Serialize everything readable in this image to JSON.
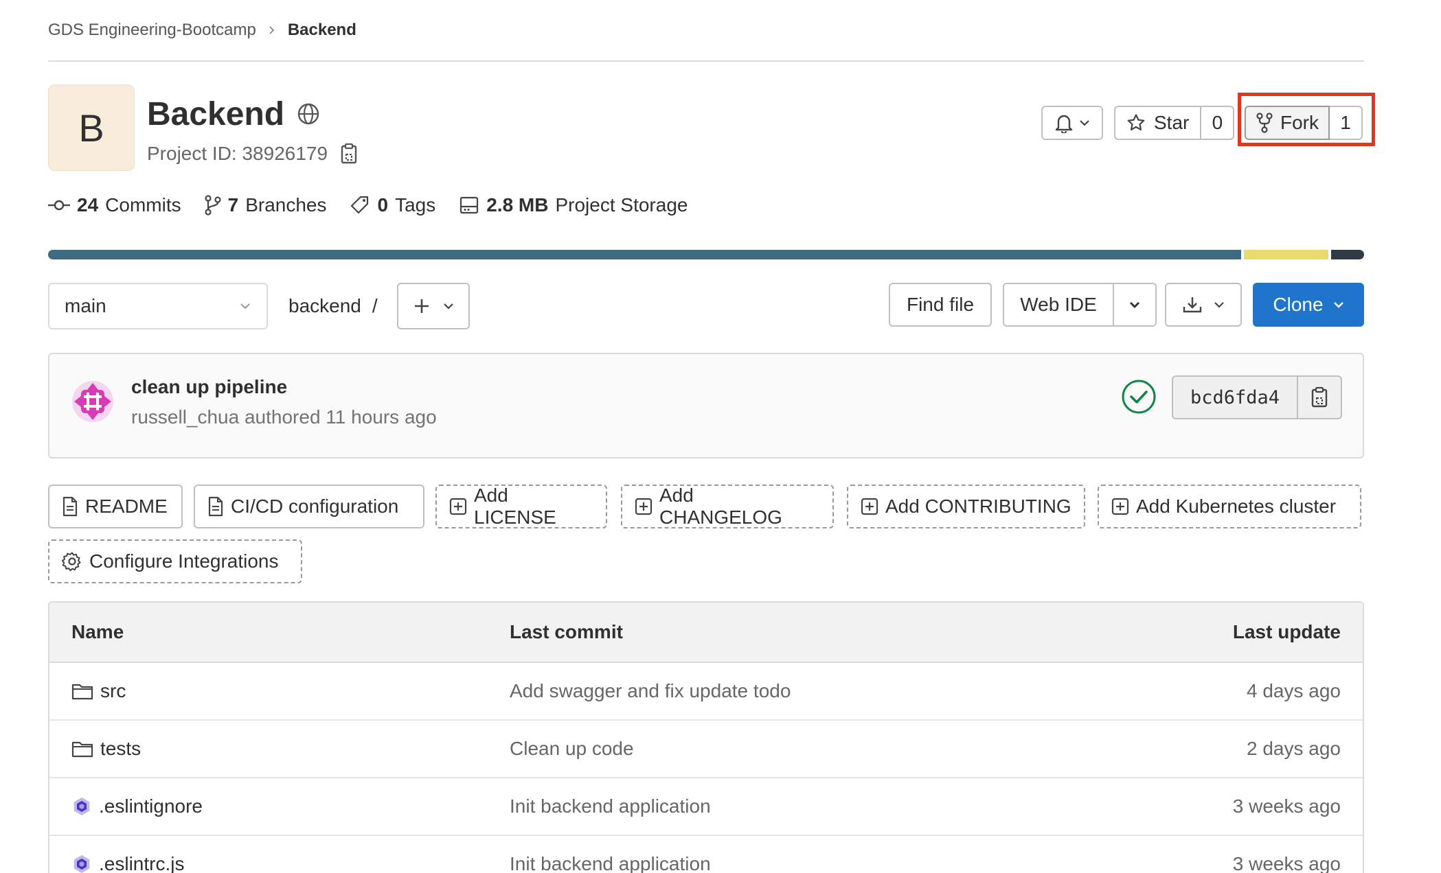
{
  "breadcrumb": {
    "group": "GDS Engineering-Bootcamp",
    "project": "Backend"
  },
  "project": {
    "avatar_letter": "B",
    "name": "Backend",
    "id_label": "Project ID: 38926179"
  },
  "header_actions": {
    "star_label": "Star",
    "star_count": "0",
    "fork_label": "Fork",
    "fork_count": "1"
  },
  "stats": [
    {
      "count": "24",
      "label": "Commits"
    },
    {
      "count": "7",
      "label": "Branches"
    },
    {
      "count": "0",
      "label": "Tags"
    },
    {
      "count": "2.8 MB",
      "label": "Project Storage"
    }
  ],
  "language_bar": [
    {
      "share": 0.8,
      "color": "#3e6b80"
    },
    {
      "share": 0.057,
      "color": "#e9dc6c"
    },
    {
      "share": 0.022,
      "color": "#2f3a44"
    }
  ],
  "toolbar": {
    "branch": "main",
    "path": "backend",
    "path_sep": "/",
    "find_file": "Find file",
    "web_ide": "Web IDE",
    "clone": "Clone"
  },
  "last_commit": {
    "title": "clean up pipeline",
    "meta": "russell_chua authored 11 hours ago",
    "sha": "bcd6fda4",
    "pipeline_status": "passed"
  },
  "quick_actions": [
    {
      "label": "README",
      "icon": "file-icon",
      "style": "solid"
    },
    {
      "label": "CI/CD configuration",
      "icon": "file-icon",
      "style": "solid"
    },
    {
      "label": "Add LICENSE",
      "icon": "plus-square-icon",
      "style": "dashed"
    },
    {
      "label": "Add CHANGELOG",
      "icon": "plus-square-icon",
      "style": "dashed"
    },
    {
      "label": "Add CONTRIBUTING",
      "icon": "plus-square-icon",
      "style": "dashed"
    },
    {
      "label": "Add Kubernetes cluster",
      "icon": "plus-square-icon",
      "style": "dashed"
    },
    {
      "label": "Configure Integrations",
      "icon": "gear-icon",
      "style": "dashed"
    }
  ],
  "file_table": {
    "headers": {
      "name": "Name",
      "last_commit": "Last commit",
      "last_update": "Last update"
    },
    "rows": [
      {
        "name": "src",
        "type": "folder",
        "commit": "Add swagger and fix update todo",
        "updated": "4 days ago"
      },
      {
        "name": "tests",
        "type": "folder",
        "commit": "Clean up code",
        "updated": "2 days ago"
      },
      {
        "name": ".eslintignore",
        "type": "eslint",
        "commit": "Init backend application",
        "updated": "3 weeks ago"
      },
      {
        "name": ".eslintrc.js",
        "type": "eslint",
        "commit": "Init backend application",
        "updated": "3 weeks ago"
      }
    ]
  },
  "colors": {
    "accent": "#1f75cb",
    "highlight": "#e0371d",
    "success": "#108548",
    "avatar_bg": "#f8eddb"
  }
}
